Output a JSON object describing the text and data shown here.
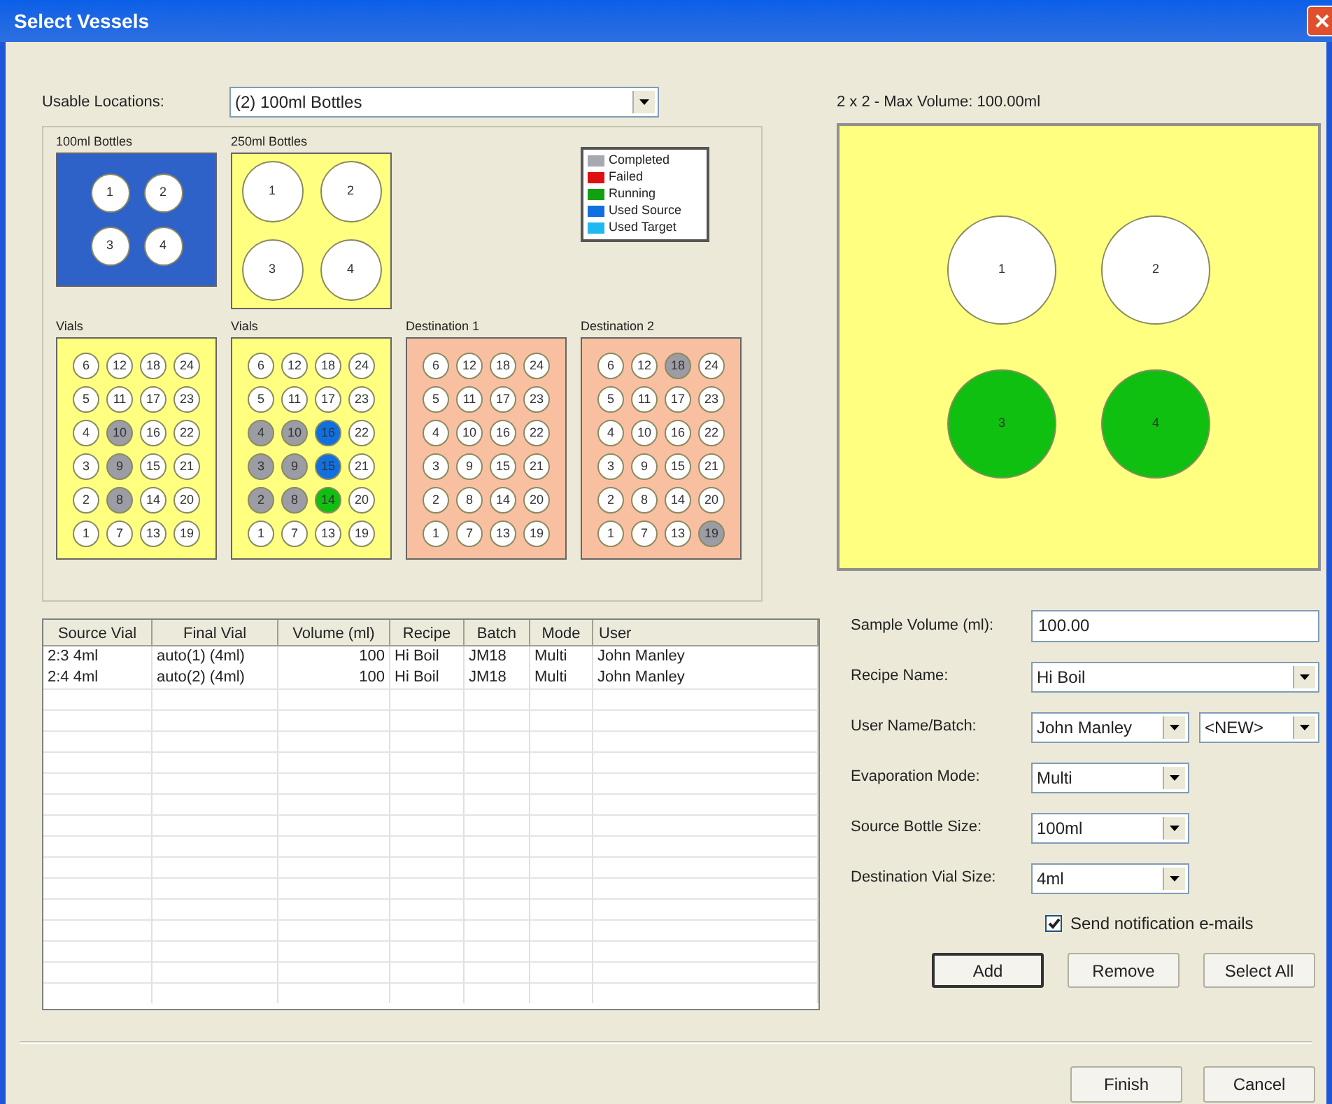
{
  "window": {
    "title": "Select Vessels"
  },
  "usable_locations": {
    "label": "Usable Locations:",
    "value": "(2)  100ml Bottles"
  },
  "racks": [
    {
      "title": "100ml Bottles",
      "kind": "small_bottles",
      "color": "#2f62c8",
      "rows": [
        [
          {
            "label": "1",
            "color": "#ffffff"
          },
          {
            "label": "2",
            "color": "#ffffff"
          }
        ],
        [
          {
            "label": "3",
            "color": "#ffffff"
          },
          {
            "label": "4",
            "color": "#ffffff"
          }
        ]
      ]
    },
    {
      "title": "250ml Bottles",
      "kind": "large_bottles",
      "color": "#ffff80",
      "rows": [
        [
          {
            "label": "1",
            "color": "#ffffff"
          },
          {
            "label": "2",
            "color": "#ffffff"
          }
        ],
        [
          {
            "label": "3",
            "color": "#ffffff"
          },
          {
            "label": "4",
            "color": "#ffffff"
          }
        ]
      ]
    },
    {
      "title": "Vials",
      "kind": "vials",
      "color": "#ffff80",
      "rows": [
        [
          {
            "label": "6",
            "color": "#ffffff"
          },
          {
            "label": "12",
            "color": "#ffffff"
          },
          {
            "label": "18",
            "color": "#ffffff"
          },
          {
            "label": "24",
            "color": "#ffffff"
          }
        ],
        [
          {
            "label": "5",
            "color": "#ffffff"
          },
          {
            "label": "11",
            "color": "#ffffff"
          },
          {
            "label": "17",
            "color": "#ffffff"
          },
          {
            "label": "23",
            "color": "#ffffff"
          }
        ],
        [
          {
            "label": "4",
            "color": "#ffffff"
          },
          {
            "label": "10",
            "color": "#9c9ca4"
          },
          {
            "label": "16",
            "color": "#ffffff"
          },
          {
            "label": "22",
            "color": "#ffffff"
          }
        ],
        [
          {
            "label": "3",
            "color": "#ffffff"
          },
          {
            "label": "9",
            "color": "#9c9ca4"
          },
          {
            "label": "15",
            "color": "#ffffff"
          },
          {
            "label": "21",
            "color": "#ffffff"
          }
        ],
        [
          {
            "label": "2",
            "color": "#ffffff"
          },
          {
            "label": "8",
            "color": "#9c9ca4"
          },
          {
            "label": "14",
            "color": "#ffffff"
          },
          {
            "label": "20",
            "color": "#ffffff"
          }
        ],
        [
          {
            "label": "1",
            "color": "#ffffff"
          },
          {
            "label": "7",
            "color": "#ffffff"
          },
          {
            "label": "13",
            "color": "#ffffff"
          },
          {
            "label": "19",
            "color": "#ffffff"
          }
        ]
      ]
    },
    {
      "title": "Vials",
      "kind": "vials",
      "color": "#ffff80",
      "rows": [
        [
          {
            "label": "6",
            "color": "#ffffff"
          },
          {
            "label": "12",
            "color": "#ffffff"
          },
          {
            "label": "18",
            "color": "#ffffff"
          },
          {
            "label": "24",
            "color": "#ffffff"
          }
        ],
        [
          {
            "label": "5",
            "color": "#ffffff"
          },
          {
            "label": "11",
            "color": "#ffffff"
          },
          {
            "label": "17",
            "color": "#ffffff"
          },
          {
            "label": "23",
            "color": "#ffffff"
          }
        ],
        [
          {
            "label": "4",
            "color": "#9c9ca4"
          },
          {
            "label": "10",
            "color": "#9c9ca4"
          },
          {
            "label": "16",
            "color": "#1070e0"
          },
          {
            "label": "22",
            "color": "#ffffff"
          }
        ],
        [
          {
            "label": "3",
            "color": "#9c9ca4"
          },
          {
            "label": "9",
            "color": "#9c9ca4"
          },
          {
            "label": "15",
            "color": "#1070e0"
          },
          {
            "label": "21",
            "color": "#ffffff"
          }
        ],
        [
          {
            "label": "2",
            "color": "#9c9ca4"
          },
          {
            "label": "8",
            "color": "#9c9ca4"
          },
          {
            "label": "14",
            "color": "#10c010"
          },
          {
            "label": "20",
            "color": "#ffffff"
          }
        ],
        [
          {
            "label": "1",
            "color": "#ffffff"
          },
          {
            "label": "7",
            "color": "#ffffff"
          },
          {
            "label": "13",
            "color": "#ffffff"
          },
          {
            "label": "19",
            "color": "#ffffff"
          }
        ]
      ]
    },
    {
      "title": "Destination 1",
      "kind": "vials",
      "color": "#f8c0a0",
      "rows": [
        [
          {
            "label": "6",
            "color": "#ffffff"
          },
          {
            "label": "12",
            "color": "#ffffff"
          },
          {
            "label": "18",
            "color": "#ffffff"
          },
          {
            "label": "24",
            "color": "#ffffff"
          }
        ],
        [
          {
            "label": "5",
            "color": "#ffffff"
          },
          {
            "label": "11",
            "color": "#ffffff"
          },
          {
            "label": "17",
            "color": "#ffffff"
          },
          {
            "label": "23",
            "color": "#ffffff"
          }
        ],
        [
          {
            "label": "4",
            "color": "#ffffff"
          },
          {
            "label": "10",
            "color": "#ffffff"
          },
          {
            "label": "16",
            "color": "#ffffff"
          },
          {
            "label": "22",
            "color": "#ffffff"
          }
        ],
        [
          {
            "label": "3",
            "color": "#ffffff"
          },
          {
            "label": "9",
            "color": "#ffffff"
          },
          {
            "label": "15",
            "color": "#ffffff"
          },
          {
            "label": "21",
            "color": "#ffffff"
          }
        ],
        [
          {
            "label": "2",
            "color": "#ffffff"
          },
          {
            "label": "8",
            "color": "#ffffff"
          },
          {
            "label": "14",
            "color": "#ffffff"
          },
          {
            "label": "20",
            "color": "#ffffff"
          }
        ],
        [
          {
            "label": "1",
            "color": "#ffffff"
          },
          {
            "label": "7",
            "color": "#ffffff"
          },
          {
            "label": "13",
            "color": "#ffffff"
          },
          {
            "label": "19",
            "color": "#ffffff"
          }
        ]
      ]
    },
    {
      "title": "Destination 2",
      "kind": "vials",
      "color": "#f8c0a0",
      "rows": [
        [
          {
            "label": "6",
            "color": "#ffffff"
          },
          {
            "label": "12",
            "color": "#ffffff"
          },
          {
            "label": "18",
            "color": "#9c9ca4"
          },
          {
            "label": "24",
            "color": "#ffffff"
          }
        ],
        [
          {
            "label": "5",
            "color": "#ffffff"
          },
          {
            "label": "11",
            "color": "#ffffff"
          },
          {
            "label": "17",
            "color": "#ffffff"
          },
          {
            "label": "23",
            "color": "#ffffff"
          }
        ],
        [
          {
            "label": "4",
            "color": "#ffffff"
          },
          {
            "label": "10",
            "color": "#ffffff"
          },
          {
            "label": "16",
            "color": "#ffffff"
          },
          {
            "label": "22",
            "color": "#ffffff"
          }
        ],
        [
          {
            "label": "3",
            "color": "#ffffff"
          },
          {
            "label": "9",
            "color": "#ffffff"
          },
          {
            "label": "15",
            "color": "#ffffff"
          },
          {
            "label": "21",
            "color": "#ffffff"
          }
        ],
        [
          {
            "label": "2",
            "color": "#ffffff"
          },
          {
            "label": "8",
            "color": "#ffffff"
          },
          {
            "label": "14",
            "color": "#ffffff"
          },
          {
            "label": "20",
            "color": "#ffffff"
          }
        ],
        [
          {
            "label": "1",
            "color": "#ffffff"
          },
          {
            "label": "7",
            "color": "#ffffff"
          },
          {
            "label": "13",
            "color": "#ffffff"
          },
          {
            "label": "19",
            "color": "#9c9ca4"
          }
        ]
      ]
    }
  ],
  "legend": [
    {
      "label": "Completed",
      "color": "#a8a8b0"
    },
    {
      "label": "Failed",
      "color": "#e01010"
    },
    {
      "label": "Running",
      "color": "#10a010"
    },
    {
      "label": "Used Source",
      "color": "#1070e0"
    },
    {
      "label": "Used Target",
      "color": "#20b8f0"
    }
  ],
  "table": {
    "columns": [
      "Source Vial",
      "Final Vial",
      "Volume (ml)",
      "Recipe",
      "Batch",
      "Mode",
      "User"
    ],
    "rows": [
      [
        "2:3 4ml",
        "auto(1) (4ml)",
        "100",
        "Hi Boil",
        "JM18",
        "Multi",
        "John Manley"
      ],
      [
        "2:4 4ml",
        "auto(2) (4ml)",
        "100",
        "Hi Boil",
        "JM18",
        "Multi",
        "John Manley"
      ]
    ]
  },
  "preview": {
    "title": "2 x 2 - Max Volume: 100.00ml",
    "rows": [
      [
        {
          "label": "1",
          "color": "#ffffff"
        },
        {
          "label": "2",
          "color": "#ffffff"
        }
      ],
      [
        {
          "label": "3",
          "color": "#10c010"
        },
        {
          "label": "4",
          "color": "#10c010"
        }
      ]
    ]
  },
  "form": [
    {
      "label": "Sample Volume (ml):",
      "kind": "input",
      "value": "100.00"
    },
    {
      "label": "Recipe Name:",
      "kind": "select_wide",
      "value": "Hi Boil"
    },
    {
      "label": "User Name/Batch:",
      "kind": "select_pair",
      "value": "John Manley",
      "value_2": "<NEW>"
    },
    {
      "label": "Evaporation Mode:",
      "kind": "select",
      "value": "Multi"
    },
    {
      "label": "Source Bottle Size:",
      "kind": "select",
      "value": "100ml"
    },
    {
      "label": "Destination Vial Size:",
      "kind": "select",
      "value": "4ml"
    }
  ],
  "notify": {
    "label": "Send notification e-mails",
    "checked": true
  },
  "action_buttons": [
    {
      "label": "Add",
      "selected": true
    },
    {
      "label": "Remove",
      "selected": false
    },
    {
      "label": "Select All",
      "selected": false
    }
  ],
  "footer_buttons": [
    "Finish",
    "Cancel"
  ]
}
